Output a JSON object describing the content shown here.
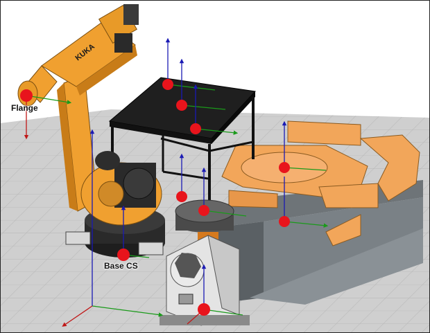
{
  "viewport": {
    "frame_labels": {
      "flange": "Flange",
      "base": "Base CS"
    },
    "colors": {
      "background": "#ffffff",
      "floor": "#cfcfcf",
      "grid": "#b4b4b4",
      "robot_orange": "#f0a030",
      "robot_dark": "#2a2a2a",
      "table": "#1b1b1b",
      "positioner_orange": "#f2a65a",
      "positioner_base": "#6e7478",
      "frame_marker": "#e8141c",
      "axis_x": "#1a9a1a",
      "axis_y": "#c01818",
      "axis_z": "#1a1ab4"
    },
    "icons": [
      "frame-marker-icon",
      "axis-triad-icon"
    ]
  }
}
